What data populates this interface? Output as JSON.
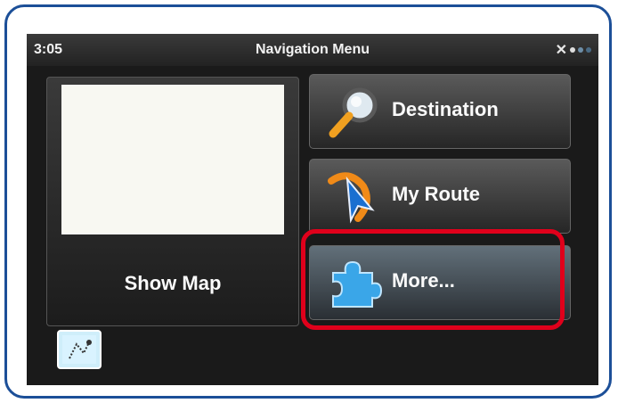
{
  "status_bar": {
    "time": "3:05",
    "title": "Navigation Menu",
    "gps_icon": "satellite-icon"
  },
  "menu": {
    "show_map_label": "Show Map",
    "destination_label": "Destination",
    "my_route_label": "My Route",
    "more_label": "More..."
  },
  "icons": {
    "destination": "magnifier-icon",
    "my_route": "route-arrow-icon",
    "more": "puzzle-piece-icon",
    "map_corner": "map-icon"
  },
  "colors": {
    "frame_border": "#1c4f98",
    "highlight": "#e0001b",
    "screen_bg": "#1a1a1a",
    "button_text": "#fafafa"
  }
}
